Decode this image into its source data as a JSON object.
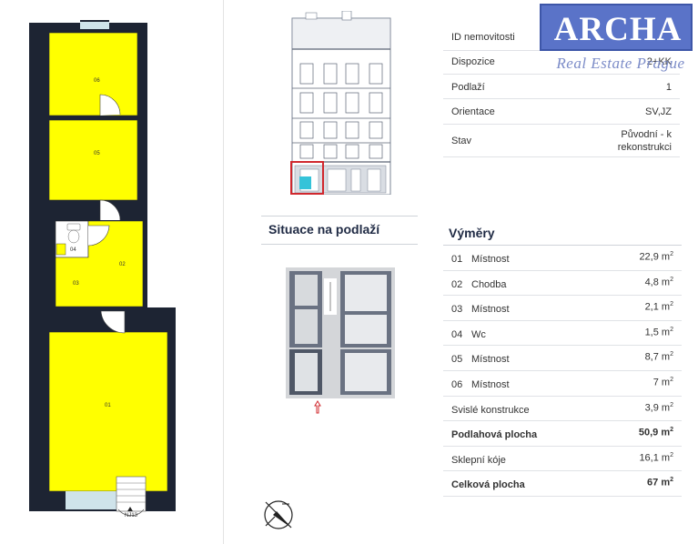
{
  "plan": {
    "rooms": [
      "06",
      "05",
      "04",
      "03",
      "02",
      "01"
    ],
    "door_label": "NJ13"
  },
  "situation": {
    "title": "Situace na podlaží"
  },
  "logo": {
    "name": "ARCHA",
    "tagline": "Real Estate Prague",
    "brand_color": "#5a73c8"
  },
  "property": [
    {
      "label": "ID nemovitosti",
      "value": ""
    },
    {
      "label": "Dispozice",
      "value": "2+KK"
    },
    {
      "label": "Podlaží",
      "value": "1"
    },
    {
      "label": "Orientace",
      "value": "SV,JZ"
    },
    {
      "label": "Stav",
      "value": "Původní - k rekonstrukci"
    }
  ],
  "areas": {
    "title": "Výměry",
    "unit": "m",
    "unit_exp": "2",
    "rooms": [
      {
        "no": "01",
        "name": "Místnost",
        "value": "22,9"
      },
      {
        "no": "02",
        "name": "Chodba",
        "value": "4,8"
      },
      {
        "no": "03",
        "name": "Místnost",
        "value": "2,1"
      },
      {
        "no": "04",
        "name": "Wc",
        "value": "1,5"
      },
      {
        "no": "05",
        "name": "Místnost",
        "value": "8,7"
      },
      {
        "no": "06",
        "name": "Místnost",
        "value": "7"
      }
    ],
    "totals": [
      {
        "label": "Svislé konstrukce",
        "value": "3,9",
        "bold": false
      },
      {
        "label": "Podlahová plocha",
        "value": "50,9",
        "bold": true
      },
      {
        "label": "Sklepní kóje",
        "value": "16,1",
        "bold": false
      },
      {
        "label": "Celková plocha",
        "value": "67",
        "bold": true
      }
    ]
  },
  "colors": {
    "room_fill": "#ffff00",
    "wall": "#1d2433",
    "accent": "#1f2a44",
    "highlight": "#d0282e"
  }
}
